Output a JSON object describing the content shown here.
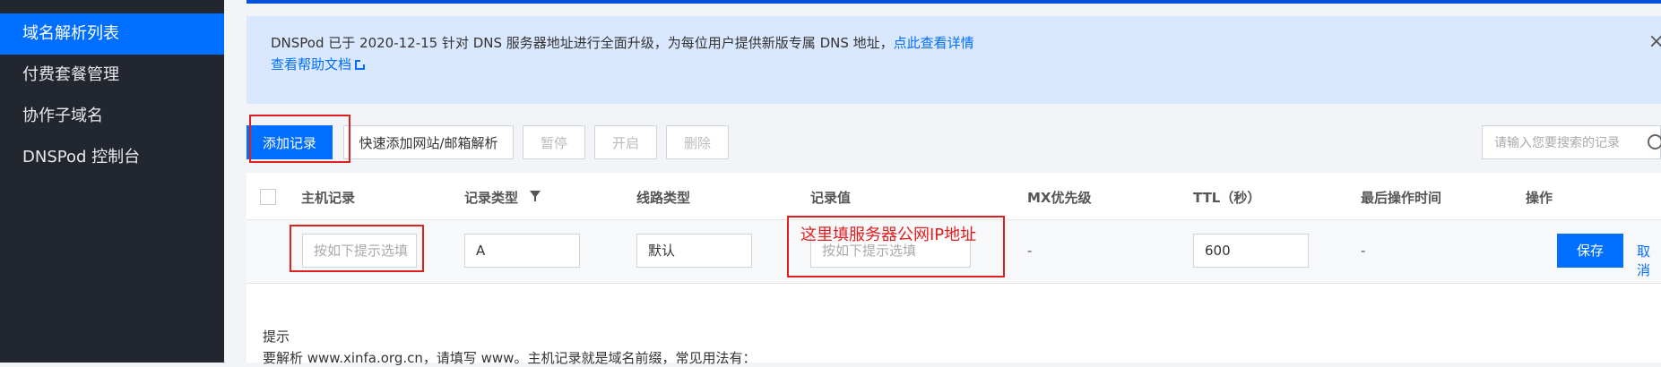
{
  "sidebar": {
    "items": [
      {
        "label": "域名解析列表",
        "active": true
      },
      {
        "label": "付费套餐管理"
      },
      {
        "label": "协作子域名"
      },
      {
        "label": "DNSPod 控制台"
      }
    ]
  },
  "notice": {
    "text": "DNSPod 已于 2020-12-15 针对 DNS 服务器地址进行全面升级，为每位用户提供新版专属 DNS 地址，",
    "link": "点此查看详情",
    "help_link": "查看帮助文档",
    "close_icon": "×"
  },
  "toolbar": {
    "add_record": "添加记录",
    "quick_add": "快速添加网站/邮箱解析",
    "pause": "暂停",
    "enable": "开启",
    "delete": "删除",
    "search_placeholder": "请输入您要搜索的记录"
  },
  "table": {
    "headers": {
      "host": "主机记录",
      "type": "记录类型",
      "line": "线路类型",
      "value": "记录值",
      "mx": "MX优先级",
      "ttl": "TTL（秒）",
      "updated": "最后操作时间",
      "actions": "操作"
    },
    "edit_row": {
      "host_placeholder": "按如下提示选填",
      "type_value": "A",
      "line_value": "默认",
      "value_placeholder": "按如下提示选填",
      "mx_value": "-",
      "ttl_value": "600",
      "updated_value": "-",
      "save": "保存",
      "cancel": "取消"
    }
  },
  "hint": {
    "title": "提示",
    "body": "要解析 www.xinfa.org.cn，请填写 www。主机记录就是域名前缀，常见用法有："
  },
  "annotation": {
    "text": "这里填服务器公网IP地址",
    "color": "#e02020"
  },
  "colors": {
    "accent": "#006eff",
    "sidebar_bg": "#22262e",
    "notice_bg": "#d9e7ff"
  }
}
